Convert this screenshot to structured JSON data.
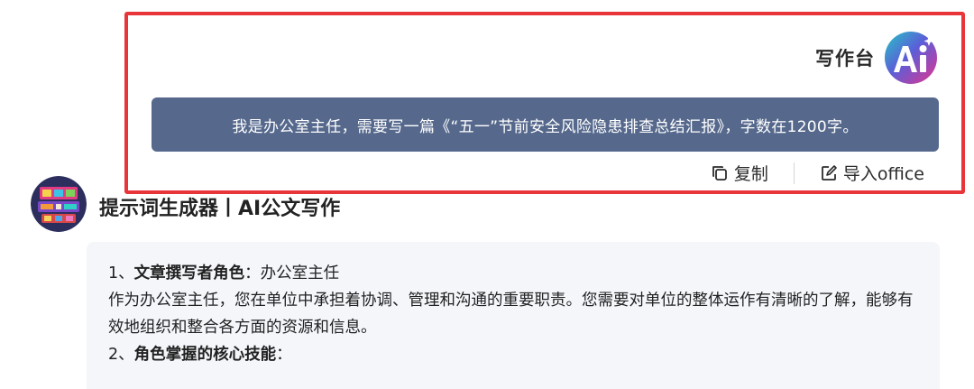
{
  "chat": {
    "assistant_name": "写作台",
    "user_message": "我是办公室主任，需要写一篇《“五一”节前安全风险隐患排查总结汇报》，字数在1200字。",
    "actions": {
      "copy_label": "复制",
      "import_label": "导入office"
    }
  },
  "bot": {
    "name": "提示词生成器丨AI公文写作"
  },
  "answer": {
    "item1_prefix": "1、",
    "item1_title": "文章撰写者角色",
    "item1_value": "：办公室主任",
    "para1": "作为办公室主任，您在单位中承担着协调、管理和沟通的重要职责。您需要对单位的整体运作有清晰的了解，能够有效地组织和整合各方面的资源和信息。",
    "item2_prefix": "2、",
    "item2_title": "角色掌握的核心技能",
    "item2_suffix": "："
  },
  "colors": {
    "highlight_border": "#e8353a",
    "user_bubble": "#56698d",
    "answer_card_bg": "#f4f6fa"
  },
  "icons": {
    "assistant_avatar": "ai-logo-icon",
    "copy": "copy-icon",
    "import": "edit-import-icon",
    "bot_avatar": "bot-avatar-image"
  }
}
